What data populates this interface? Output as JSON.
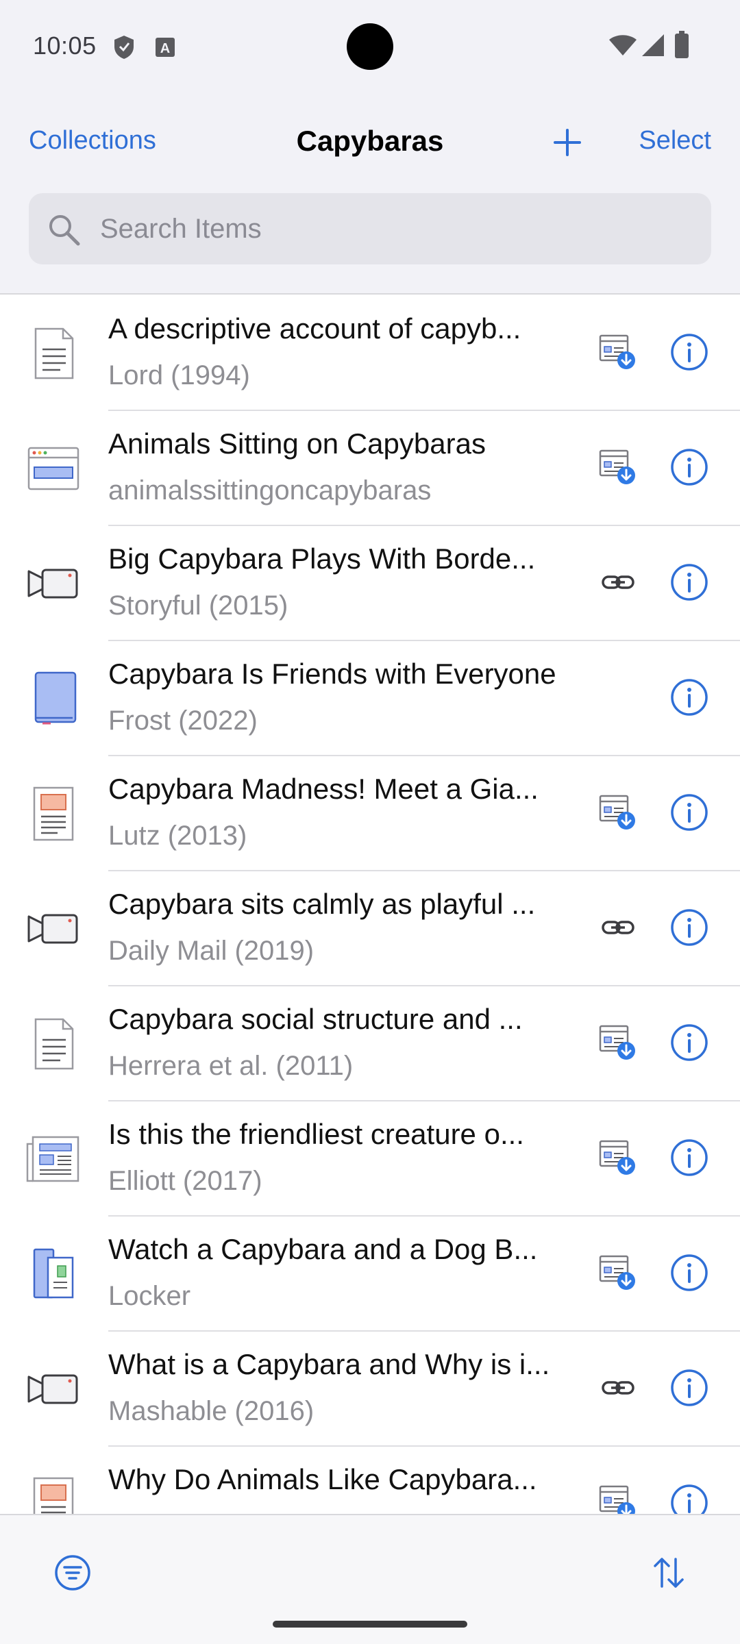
{
  "status_bar": {
    "time": "10:05",
    "icons": [
      "shield-icon",
      "text-a-icon",
      "wifi-icon",
      "signal-icon",
      "battery-icon"
    ]
  },
  "header": {
    "back_label": "Collections",
    "title": "Capybaras",
    "add_icon": "plus-icon",
    "select_label": "Select"
  },
  "search": {
    "placeholder": "Search Items",
    "icon": "search-icon"
  },
  "items": [
    {
      "title": "A descriptive account of capyb...",
      "subtitle": "Lord (1994)",
      "type": "document",
      "attachment": "web-snapshot"
    },
    {
      "title": "Animals Sitting on Capybaras",
      "subtitle": "animalssittingoncapybaras",
      "type": "webpage",
      "attachment": "web-snapshot"
    },
    {
      "title": "Big Capybara Plays With Borde...",
      "subtitle": "Storyful (2015)",
      "type": "video",
      "attachment": "link"
    },
    {
      "title": "Capybara Is Friends with Everyone",
      "subtitle": "Frost (2022)",
      "type": "book",
      "attachment": "none"
    },
    {
      "title": "Capybara Madness! Meet a Gia...",
      "subtitle": "Lutz (2013)",
      "type": "magazine-article",
      "attachment": "web-snapshot"
    },
    {
      "title": "Capybara sits calmly as playful ...",
      "subtitle": "Daily Mail (2019)",
      "type": "video",
      "attachment": "link"
    },
    {
      "title": "Capybara social structure and ...",
      "subtitle": "Herrera et al. (2011)",
      "type": "document",
      "attachment": "web-snapshot"
    },
    {
      "title": "Is this the friendliest creature o...",
      "subtitle": "Elliott (2017)",
      "type": "newspaper-article",
      "attachment": "web-snapshot"
    },
    {
      "title": "Watch a Capybara and a Dog B...",
      "subtitle": "Locker",
      "type": "book-section",
      "attachment": "web-snapshot"
    },
    {
      "title": "What is a Capybara and Why is i...",
      "subtitle": "Mashable (2016)",
      "type": "video",
      "attachment": "link"
    },
    {
      "title": "Why Do Animals Like Capybara...",
      "subtitle": "",
      "type": "magazine-article",
      "attachment": "web-snapshot"
    }
  ],
  "toolbar": {
    "filter_icon": "filter-icon",
    "sort_icon": "sort-icon"
  },
  "colors": {
    "accent": "#2f6fd6",
    "header_bg": "#f2f2f7",
    "secondary_text": "#8e8e93"
  }
}
